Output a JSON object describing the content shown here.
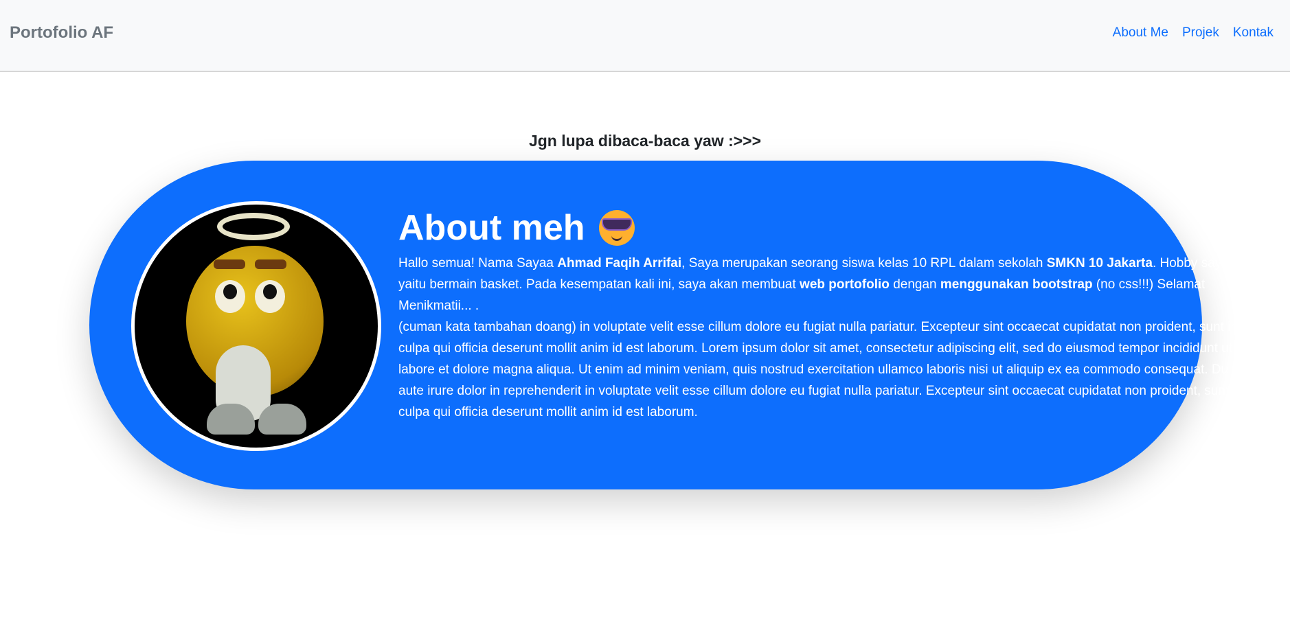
{
  "navbar": {
    "brand": "Portofolio AF",
    "links": [
      "About Me",
      "Projek",
      "Kontak"
    ]
  },
  "tagline": "Jgn lupa dibaca-baca yaw :>>>",
  "about": {
    "heading": "About meh",
    "heading_emoji": "smiling-face-with-sunglasses",
    "avatar": "angel-emoji-character-image",
    "p1": {
      "t1": "Hallo semua! Nama Sayaa ",
      "b1": "Ahmad Faqih Arrifai",
      "t2": ", Saya merupakan seorang siswa kelas 10 RPL dalam sekolah ",
      "b2": "SMKN 10 Jakarta",
      "t3": ". Hobby saya yaitu bermain basket. Pada kesempatan kali ini, saya akan membuat ",
      "b3": "web portofolio",
      "t4": " dengan ",
      "b4": "menggunakan bootstrap",
      "t5": " (no css!!!) Selamat Menikmatii... ."
    },
    "p2": "(cuman kata tambahan doang) in voluptate velit esse cillum dolore eu fugiat nulla pariatur. Excepteur sint occaecat cupidatat non proident, sunt in culpa qui officia deserunt mollit anim id est laborum. Lorem ipsum dolor sit amet, consectetur adipiscing elit, sed do eiusmod tempor incididunt ut labore et dolore magna aliqua. Ut enim ad minim veniam, quis nostrud exercitation ullamco laboris nisi ut aliquip ex ea commodo consequat. Duis aute irure dolor in reprehenderit in voluptate velit esse cillum dolore eu fugiat nulla pariatur. Excepteur sint occaecat cupidatat non proident, sunt in culpa qui officia deserunt mollit anim id est laborum."
  },
  "colors": {
    "primary": "#0d6efd",
    "navbar_bg": "#f8f9fa",
    "brand": "#6c757d"
  }
}
